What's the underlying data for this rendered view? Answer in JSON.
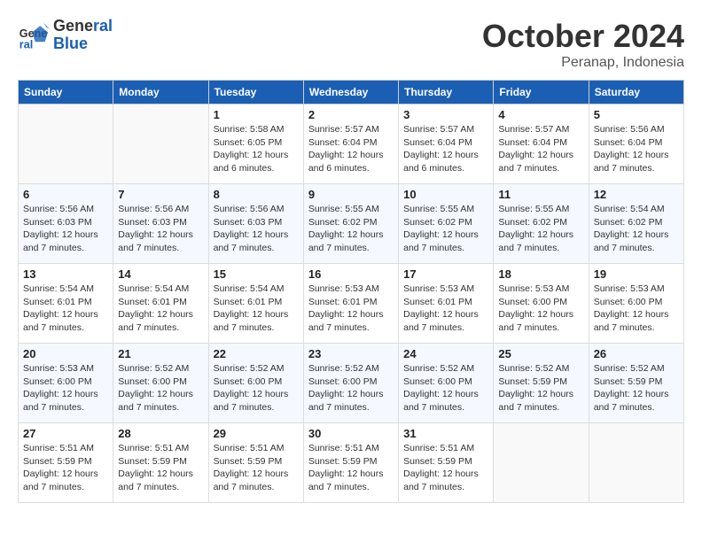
{
  "header": {
    "logo_line1": "General",
    "logo_line2": "Blue",
    "month": "October 2024",
    "location": "Peranap, Indonesia"
  },
  "days_of_week": [
    "Sunday",
    "Monday",
    "Tuesday",
    "Wednesday",
    "Thursday",
    "Friday",
    "Saturday"
  ],
  "weeks": [
    [
      {
        "day": "",
        "detail": ""
      },
      {
        "day": "",
        "detail": ""
      },
      {
        "day": "1",
        "detail": "Sunrise: 5:58 AM\nSunset: 6:05 PM\nDaylight: 12 hours\nand 6 minutes."
      },
      {
        "day": "2",
        "detail": "Sunrise: 5:57 AM\nSunset: 6:04 PM\nDaylight: 12 hours\nand 6 minutes."
      },
      {
        "day": "3",
        "detail": "Sunrise: 5:57 AM\nSunset: 6:04 PM\nDaylight: 12 hours\nand 6 minutes."
      },
      {
        "day": "4",
        "detail": "Sunrise: 5:57 AM\nSunset: 6:04 PM\nDaylight: 12 hours\nand 7 minutes."
      },
      {
        "day": "5",
        "detail": "Sunrise: 5:56 AM\nSunset: 6:04 PM\nDaylight: 12 hours\nand 7 minutes."
      }
    ],
    [
      {
        "day": "6",
        "detail": "Sunrise: 5:56 AM\nSunset: 6:03 PM\nDaylight: 12 hours\nand 7 minutes."
      },
      {
        "day": "7",
        "detail": "Sunrise: 5:56 AM\nSunset: 6:03 PM\nDaylight: 12 hours\nand 7 minutes."
      },
      {
        "day": "8",
        "detail": "Sunrise: 5:56 AM\nSunset: 6:03 PM\nDaylight: 12 hours\nand 7 minutes."
      },
      {
        "day": "9",
        "detail": "Sunrise: 5:55 AM\nSunset: 6:02 PM\nDaylight: 12 hours\nand 7 minutes."
      },
      {
        "day": "10",
        "detail": "Sunrise: 5:55 AM\nSunset: 6:02 PM\nDaylight: 12 hours\nand 7 minutes."
      },
      {
        "day": "11",
        "detail": "Sunrise: 5:55 AM\nSunset: 6:02 PM\nDaylight: 12 hours\nand 7 minutes."
      },
      {
        "day": "12",
        "detail": "Sunrise: 5:54 AM\nSunset: 6:02 PM\nDaylight: 12 hours\nand 7 minutes."
      }
    ],
    [
      {
        "day": "13",
        "detail": "Sunrise: 5:54 AM\nSunset: 6:01 PM\nDaylight: 12 hours\nand 7 minutes."
      },
      {
        "day": "14",
        "detail": "Sunrise: 5:54 AM\nSunset: 6:01 PM\nDaylight: 12 hours\nand 7 minutes."
      },
      {
        "day": "15",
        "detail": "Sunrise: 5:54 AM\nSunset: 6:01 PM\nDaylight: 12 hours\nand 7 minutes."
      },
      {
        "day": "16",
        "detail": "Sunrise: 5:53 AM\nSunset: 6:01 PM\nDaylight: 12 hours\nand 7 minutes."
      },
      {
        "day": "17",
        "detail": "Sunrise: 5:53 AM\nSunset: 6:01 PM\nDaylight: 12 hours\nand 7 minutes."
      },
      {
        "day": "18",
        "detail": "Sunrise: 5:53 AM\nSunset: 6:00 PM\nDaylight: 12 hours\nand 7 minutes."
      },
      {
        "day": "19",
        "detail": "Sunrise: 5:53 AM\nSunset: 6:00 PM\nDaylight: 12 hours\nand 7 minutes."
      }
    ],
    [
      {
        "day": "20",
        "detail": "Sunrise: 5:53 AM\nSunset: 6:00 PM\nDaylight: 12 hours\nand 7 minutes."
      },
      {
        "day": "21",
        "detail": "Sunrise: 5:52 AM\nSunset: 6:00 PM\nDaylight: 12 hours\nand 7 minutes."
      },
      {
        "day": "22",
        "detail": "Sunrise: 5:52 AM\nSunset: 6:00 PM\nDaylight: 12 hours\nand 7 minutes."
      },
      {
        "day": "23",
        "detail": "Sunrise: 5:52 AM\nSunset: 6:00 PM\nDaylight: 12 hours\nand 7 minutes."
      },
      {
        "day": "24",
        "detail": "Sunrise: 5:52 AM\nSunset: 6:00 PM\nDaylight: 12 hours\nand 7 minutes."
      },
      {
        "day": "25",
        "detail": "Sunrise: 5:52 AM\nSunset: 5:59 PM\nDaylight: 12 hours\nand 7 minutes."
      },
      {
        "day": "26",
        "detail": "Sunrise: 5:52 AM\nSunset: 5:59 PM\nDaylight: 12 hours\nand 7 minutes."
      }
    ],
    [
      {
        "day": "27",
        "detail": "Sunrise: 5:51 AM\nSunset: 5:59 PM\nDaylight: 12 hours\nand 7 minutes."
      },
      {
        "day": "28",
        "detail": "Sunrise: 5:51 AM\nSunset: 5:59 PM\nDaylight: 12 hours\nand 7 minutes."
      },
      {
        "day": "29",
        "detail": "Sunrise: 5:51 AM\nSunset: 5:59 PM\nDaylight: 12 hours\nand 7 minutes."
      },
      {
        "day": "30",
        "detail": "Sunrise: 5:51 AM\nSunset: 5:59 PM\nDaylight: 12 hours\nand 7 minutes."
      },
      {
        "day": "31",
        "detail": "Sunrise: 5:51 AM\nSunset: 5:59 PM\nDaylight: 12 hours\nand 7 minutes."
      },
      {
        "day": "",
        "detail": ""
      },
      {
        "day": "",
        "detail": ""
      }
    ]
  ]
}
